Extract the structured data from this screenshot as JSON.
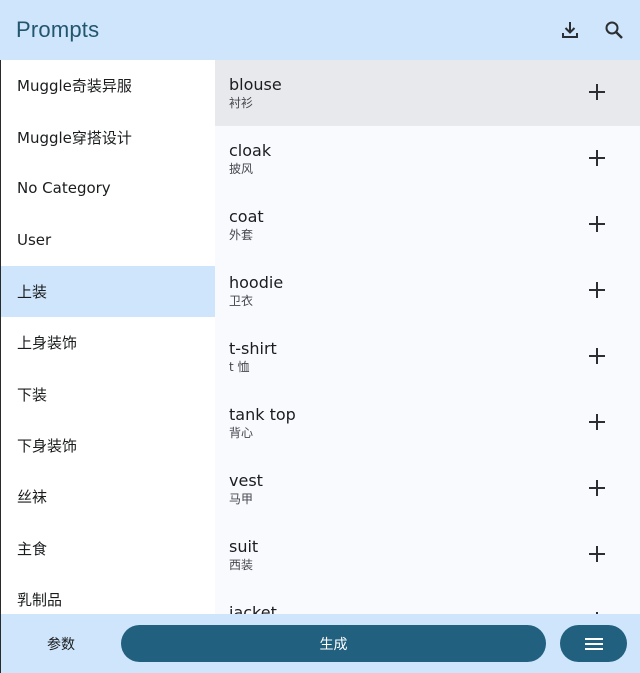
{
  "header": {
    "title": "Prompts",
    "icons": [
      "download-icon",
      "search-icon"
    ]
  },
  "sidebar": {
    "items": [
      {
        "label": "Muggle奇装异服",
        "active": false
      },
      {
        "label": "Muggle穿搭设计",
        "active": false
      },
      {
        "label": "No Category",
        "active": false
      },
      {
        "label": "User",
        "active": false
      },
      {
        "label": "上装",
        "active": true
      },
      {
        "label": "上身装饰",
        "active": false
      },
      {
        "label": "下装",
        "active": false
      },
      {
        "label": "下身装饰",
        "active": false
      },
      {
        "label": "丝袜",
        "active": false
      },
      {
        "label": "主食",
        "active": false
      },
      {
        "label": "乳制品",
        "active": false
      }
    ]
  },
  "prompts": {
    "items": [
      {
        "name": "blouse",
        "translation": "衬衫",
        "active": true
      },
      {
        "name": "cloak",
        "translation": "披风",
        "active": false
      },
      {
        "name": "coat",
        "translation": "外套",
        "active": false
      },
      {
        "name": "hoodie",
        "translation": "卫衣",
        "active": false
      },
      {
        "name": "t-shirt",
        "translation": "t 恤",
        "active": false
      },
      {
        "name": "tank top",
        "translation": "背心",
        "active": false
      },
      {
        "name": "vest",
        "translation": "马甲",
        "active": false
      },
      {
        "name": "suit",
        "translation": "西装",
        "active": false
      },
      {
        "name": "jacket",
        "translation": "",
        "active": false
      }
    ]
  },
  "bottombar": {
    "params_label": "参数",
    "generate_label": "生成"
  },
  "colors": {
    "accent": "#22607f",
    "header_bg": "#cfe5fb",
    "selected_row": "#e8e9ec",
    "title": "#22566f"
  }
}
